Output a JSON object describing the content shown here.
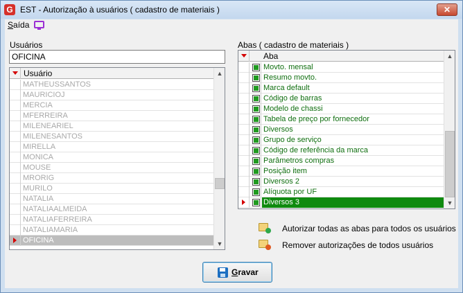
{
  "window": {
    "title": "EST - Autorização à usuários ( cadastro de materiais )",
    "app_icon_letter": "G",
    "close_glyph": "✕"
  },
  "menu": {
    "saida_underlined": "S",
    "saida_rest": "aída",
    "icon": "monitor-icon"
  },
  "usuarios": {
    "label": "Usuários",
    "value": "OFICINA",
    "column_header": "Usuário",
    "rows": [
      "MATHEUSSANTOS",
      "MAURICIOJ",
      "MERCIA",
      "MFERREIRA",
      "MILENEARIEL",
      "MILENESANTOS",
      "MIRELLA",
      "MONICA",
      "MOUSE",
      "MRORIG",
      "MURILO",
      "NATALIA",
      "NATALIAALMEIDA",
      "NATALIAFERREIRA",
      "NATALIAMARIA",
      "OFICINA"
    ],
    "selected_index": 15
  },
  "abas": {
    "label": "Abas ( cadastro de materiais )",
    "column_header": "Aba",
    "rows": [
      "Movto. mensal",
      "Resumo movto.",
      "Marca default",
      "Código de barras",
      "Modelo de chassi",
      "Tabela de preço por fornecedor",
      "Diversos",
      "Grupo de serviço",
      "Código de referência da marca",
      "Parâmetros compras",
      "Posição item",
      "Diversos 2",
      "Alíquota por UF",
      "Diversos 3"
    ],
    "selected_index": 13
  },
  "actions": {
    "authorize_all": "Autorizar todas as abas para todos os usuários",
    "remove_all": "Remover autorizações de todos usuários"
  },
  "save": {
    "underlined": "G",
    "rest": "ravar"
  },
  "colors": {
    "selected_aba": "#0f8a0f",
    "aba_text": "#0f6e0f",
    "disabled_user_text": "#a8a8a8",
    "indicator_red": "#d40000"
  }
}
